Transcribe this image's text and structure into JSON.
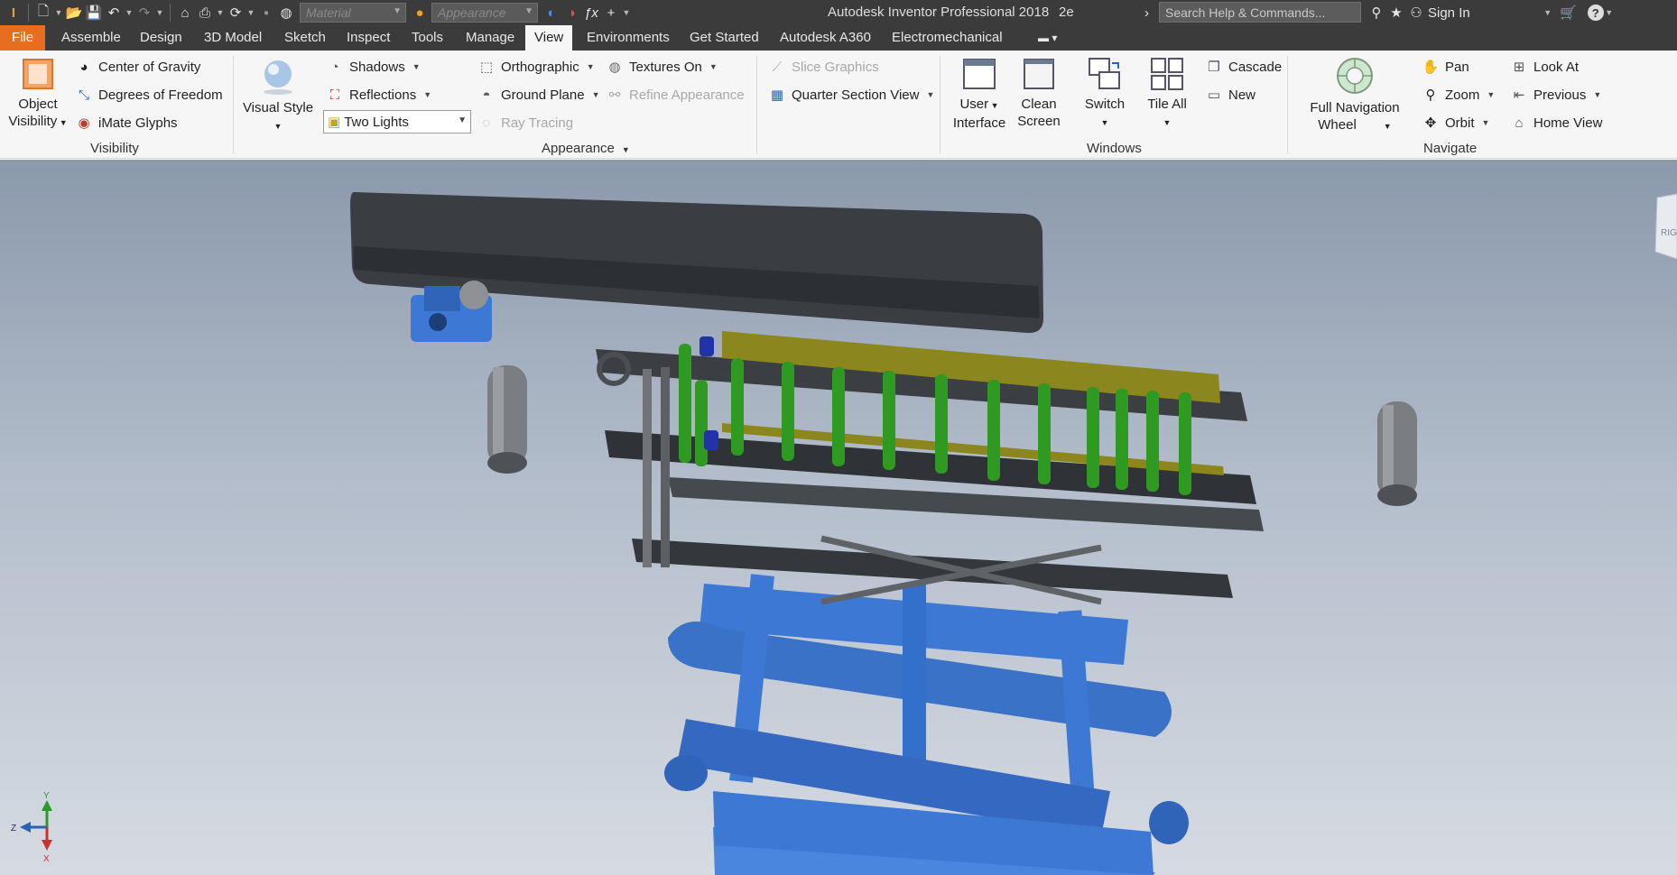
{
  "window": {
    "app_title": "Autodesk Inventor Professional 2018",
    "document_name": "2e",
    "search_placeholder": "Search Help & Commands...",
    "sign_in": "Sign In"
  },
  "quick_access": {
    "material_placeholder": "Material",
    "appearance_placeholder": "Appearance"
  },
  "tabs": [
    {
      "label": "File"
    },
    {
      "label": "Assemble"
    },
    {
      "label": "Design"
    },
    {
      "label": "3D Model"
    },
    {
      "label": "Sketch"
    },
    {
      "label": "Inspect"
    },
    {
      "label": "Tools"
    },
    {
      "label": "Manage"
    },
    {
      "label": "View"
    },
    {
      "label": "Environments"
    },
    {
      "label": "Get Started"
    },
    {
      "label": "Autodesk A360"
    },
    {
      "label": "Electromechanical"
    }
  ],
  "ribbon": {
    "visibility": {
      "label": "Visibility",
      "object_visibility_1": "Object",
      "object_visibility_2": "Visibility",
      "center_of_gravity": "Center of Gravity",
      "degrees_of_freedom": "Degrees of Freedom",
      "imate_glyphs": "iMate Glyphs"
    },
    "appearance": {
      "label": "Appearance",
      "visual_style": "Visual Style",
      "shadows": "Shadows",
      "reflections": "Reflections",
      "lighting_value": "Two Lights",
      "orthographic": "Orthographic",
      "ground_plane": "Ground Plane",
      "ray_tracing": "Ray Tracing",
      "textures_on": "Textures On",
      "refine_appearance": "Refine Appearance",
      "slice_graphics": "Slice Graphics",
      "quarter_section_view": "Quarter Section View"
    },
    "windows": {
      "label": "Windows",
      "user_interface_1": "User",
      "user_interface_2": "Interface",
      "clean_screen_1": "Clean",
      "clean_screen_2": "Screen",
      "switch": "Switch",
      "tile_all": "Tile All",
      "cascade": "Cascade",
      "new": "New"
    },
    "navigate": {
      "label": "Navigate",
      "full_nav_wheel_1": "Full Navigation",
      "full_nav_wheel_2": "Wheel",
      "pan": "Pan",
      "zoom": "Zoom",
      "orbit": "Orbit",
      "look_at": "Look At",
      "previous": "Previous",
      "home_view": "Home View"
    }
  },
  "viewport": {
    "viewcube_face": "RIG",
    "axis_x": "X",
    "axis_y": "Y",
    "axis_z": "Z"
  },
  "colors": {
    "title_bar": "#3b3b3b",
    "file_tab": "#e86d1f",
    "ribbon": "#f6f6f6",
    "belt": "#3a3d41",
    "frame_blue": "#3d79d4",
    "roller_green": "#2f9a22",
    "olive_plate": "#8c861e"
  }
}
